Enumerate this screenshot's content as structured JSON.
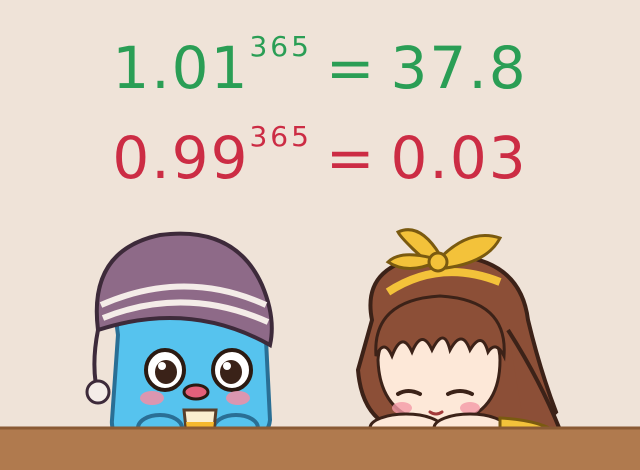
{
  "equations": [
    {
      "base": "1.01",
      "exponent": "365",
      "operator": "=",
      "result": "37.8",
      "color": "#2a9e55"
    },
    {
      "base": "0.99",
      "exponent": "365",
      "operator": "=",
      "result": "0.03",
      "color": "#cc2c44"
    }
  ],
  "colors": {
    "background": "#efe3d8",
    "table": "#b07a4e",
    "hat": "#8e6a88",
    "blob": "#56c3ee",
    "hair": "#8c4f37",
    "ribbon": "#f3c23a",
    "juice": "#f5b82e"
  },
  "characters": {
    "left": {
      "icon": "blob-character-icon",
      "holding": "juice-cup-icon"
    },
    "right": {
      "icon": "girl-character-icon",
      "accessory": "ribbon-bow-icon"
    }
  }
}
